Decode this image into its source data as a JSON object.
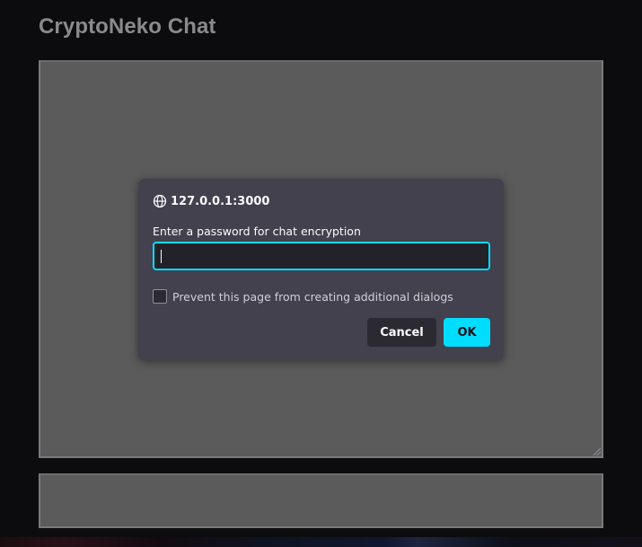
{
  "app": {
    "title": "CryptoNeko Chat"
  },
  "dialog": {
    "origin": "127.0.0.1:3000",
    "message": "Enter a password for chat encryption",
    "input_value": "",
    "checkbox_label": "Prevent this page from creating additional dialogs",
    "checkbox_checked": false,
    "cancel_label": "Cancel",
    "ok_label": "OK",
    "icons": {
      "origin": "globe-icon"
    },
    "colors": {
      "accent": "#00ddff",
      "surface": "#42414d"
    }
  }
}
